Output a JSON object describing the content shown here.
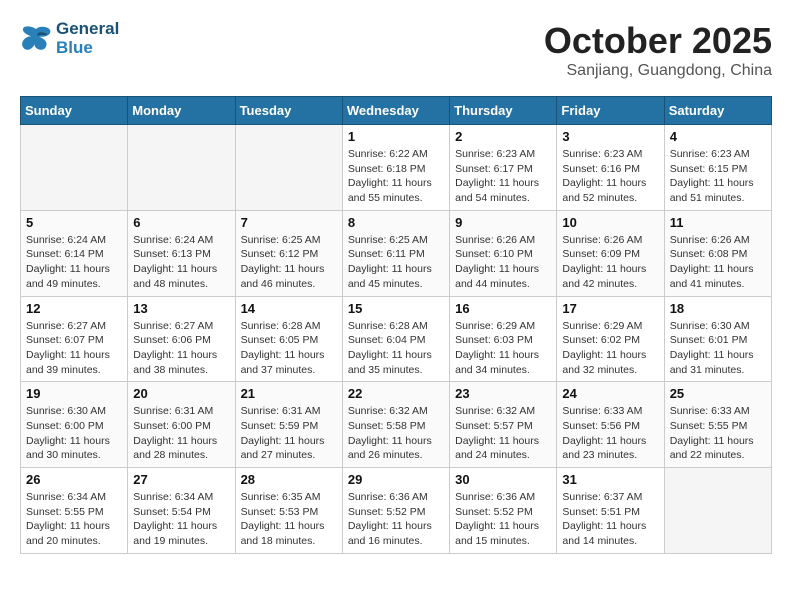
{
  "logo": {
    "line1": "General",
    "line2": "Blue"
  },
  "title": "October 2025",
  "subtitle": "Sanjiang, Guangdong, China",
  "weekdays": [
    "Sunday",
    "Monday",
    "Tuesday",
    "Wednesday",
    "Thursday",
    "Friday",
    "Saturday"
  ],
  "weeks": [
    [
      {
        "day": "",
        "info": ""
      },
      {
        "day": "",
        "info": ""
      },
      {
        "day": "",
        "info": ""
      },
      {
        "day": "1",
        "info": "Sunrise: 6:22 AM\nSunset: 6:18 PM\nDaylight: 11 hours\nand 55 minutes."
      },
      {
        "day": "2",
        "info": "Sunrise: 6:23 AM\nSunset: 6:17 PM\nDaylight: 11 hours\nand 54 minutes."
      },
      {
        "day": "3",
        "info": "Sunrise: 6:23 AM\nSunset: 6:16 PM\nDaylight: 11 hours\nand 52 minutes."
      },
      {
        "day": "4",
        "info": "Sunrise: 6:23 AM\nSunset: 6:15 PM\nDaylight: 11 hours\nand 51 minutes."
      }
    ],
    [
      {
        "day": "5",
        "info": "Sunrise: 6:24 AM\nSunset: 6:14 PM\nDaylight: 11 hours\nand 49 minutes."
      },
      {
        "day": "6",
        "info": "Sunrise: 6:24 AM\nSunset: 6:13 PM\nDaylight: 11 hours\nand 48 minutes."
      },
      {
        "day": "7",
        "info": "Sunrise: 6:25 AM\nSunset: 6:12 PM\nDaylight: 11 hours\nand 46 minutes."
      },
      {
        "day": "8",
        "info": "Sunrise: 6:25 AM\nSunset: 6:11 PM\nDaylight: 11 hours\nand 45 minutes."
      },
      {
        "day": "9",
        "info": "Sunrise: 6:26 AM\nSunset: 6:10 PM\nDaylight: 11 hours\nand 44 minutes."
      },
      {
        "day": "10",
        "info": "Sunrise: 6:26 AM\nSunset: 6:09 PM\nDaylight: 11 hours\nand 42 minutes."
      },
      {
        "day": "11",
        "info": "Sunrise: 6:26 AM\nSunset: 6:08 PM\nDaylight: 11 hours\nand 41 minutes."
      }
    ],
    [
      {
        "day": "12",
        "info": "Sunrise: 6:27 AM\nSunset: 6:07 PM\nDaylight: 11 hours\nand 39 minutes."
      },
      {
        "day": "13",
        "info": "Sunrise: 6:27 AM\nSunset: 6:06 PM\nDaylight: 11 hours\nand 38 minutes."
      },
      {
        "day": "14",
        "info": "Sunrise: 6:28 AM\nSunset: 6:05 PM\nDaylight: 11 hours\nand 37 minutes."
      },
      {
        "day": "15",
        "info": "Sunrise: 6:28 AM\nSunset: 6:04 PM\nDaylight: 11 hours\nand 35 minutes."
      },
      {
        "day": "16",
        "info": "Sunrise: 6:29 AM\nSunset: 6:03 PM\nDaylight: 11 hours\nand 34 minutes."
      },
      {
        "day": "17",
        "info": "Sunrise: 6:29 AM\nSunset: 6:02 PM\nDaylight: 11 hours\nand 32 minutes."
      },
      {
        "day": "18",
        "info": "Sunrise: 6:30 AM\nSunset: 6:01 PM\nDaylight: 11 hours\nand 31 minutes."
      }
    ],
    [
      {
        "day": "19",
        "info": "Sunrise: 6:30 AM\nSunset: 6:00 PM\nDaylight: 11 hours\nand 30 minutes."
      },
      {
        "day": "20",
        "info": "Sunrise: 6:31 AM\nSunset: 6:00 PM\nDaylight: 11 hours\nand 28 minutes."
      },
      {
        "day": "21",
        "info": "Sunrise: 6:31 AM\nSunset: 5:59 PM\nDaylight: 11 hours\nand 27 minutes."
      },
      {
        "day": "22",
        "info": "Sunrise: 6:32 AM\nSunset: 5:58 PM\nDaylight: 11 hours\nand 26 minutes."
      },
      {
        "day": "23",
        "info": "Sunrise: 6:32 AM\nSunset: 5:57 PM\nDaylight: 11 hours\nand 24 minutes."
      },
      {
        "day": "24",
        "info": "Sunrise: 6:33 AM\nSunset: 5:56 PM\nDaylight: 11 hours\nand 23 minutes."
      },
      {
        "day": "25",
        "info": "Sunrise: 6:33 AM\nSunset: 5:55 PM\nDaylight: 11 hours\nand 22 minutes."
      }
    ],
    [
      {
        "day": "26",
        "info": "Sunrise: 6:34 AM\nSunset: 5:55 PM\nDaylight: 11 hours\nand 20 minutes."
      },
      {
        "day": "27",
        "info": "Sunrise: 6:34 AM\nSunset: 5:54 PM\nDaylight: 11 hours\nand 19 minutes."
      },
      {
        "day": "28",
        "info": "Sunrise: 6:35 AM\nSunset: 5:53 PM\nDaylight: 11 hours\nand 18 minutes."
      },
      {
        "day": "29",
        "info": "Sunrise: 6:36 AM\nSunset: 5:52 PM\nDaylight: 11 hours\nand 16 minutes."
      },
      {
        "day": "30",
        "info": "Sunrise: 6:36 AM\nSunset: 5:52 PM\nDaylight: 11 hours\nand 15 minutes."
      },
      {
        "day": "31",
        "info": "Sunrise: 6:37 AM\nSunset: 5:51 PM\nDaylight: 11 hours\nand 14 minutes."
      },
      {
        "day": "",
        "info": ""
      }
    ]
  ]
}
